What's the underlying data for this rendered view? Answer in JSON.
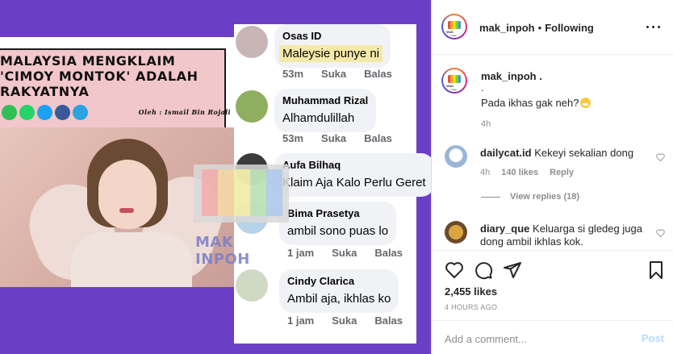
{
  "post": {
    "username": "mak_inpoh",
    "follow_sep": "•",
    "follow_status": "Following",
    "caption_dot": ".",
    "caption_text": "Pada ikhas gak neh?",
    "caption_time": "4h",
    "avatar_label": "MAK INPOH"
  },
  "comments": [
    {
      "username": "dailycat.id",
      "text": "Kekeyi sekalian dong",
      "time": "4h",
      "likes": "140 likes",
      "reply_label": "Reply",
      "view_replies": "View replies (18)"
    },
    {
      "username": "diary_que",
      "text": "Keluarga si gledeg juga dong ambil ikhlas kok."
    }
  ],
  "actions": {
    "likes": "2,455 likes",
    "time_ago": "4 HOURS AGO",
    "add_comment_placeholder": "Add a comment...",
    "post_label": "Post"
  },
  "media": {
    "headline": [
      "MALAYSIA MENGKLAIM",
      "'CIMOY MONTOK' ADALAH",
      "RAKYATNYA"
    ],
    "byline": "Oleh : Ismail Bin Rojali",
    "watermark": "MAK INPOH",
    "share_colors": [
      "#2fbf55",
      "#25d366",
      "#1da1f2",
      "#3b5998",
      "#2aa3df"
    ],
    "comments": [
      {
        "name": "Osas ID",
        "text": "Maleysie punye ni",
        "time": "53m",
        "like": "Suka",
        "reply": "Balas",
        "highlight": true
      },
      {
        "name": "Muhammad Rizal",
        "text": "Alhamdulillah",
        "time": "53m",
        "like": "Suka",
        "reply": "Balas"
      },
      {
        "name": "Aufa Bilhaq",
        "text": "Klaim Aja Kalo Perlu Geret"
      },
      {
        "name": "Bima Prasetya",
        "text": "ambil sono puas lo",
        "time": "1 jam",
        "like": "Suka",
        "reply": "Balas"
      },
      {
        "name": "Cindy Clarica",
        "text": "Ambil aja, ikhlas ko",
        "time": "1 jam",
        "like": "Suka",
        "reply": "Balas"
      }
    ]
  }
}
